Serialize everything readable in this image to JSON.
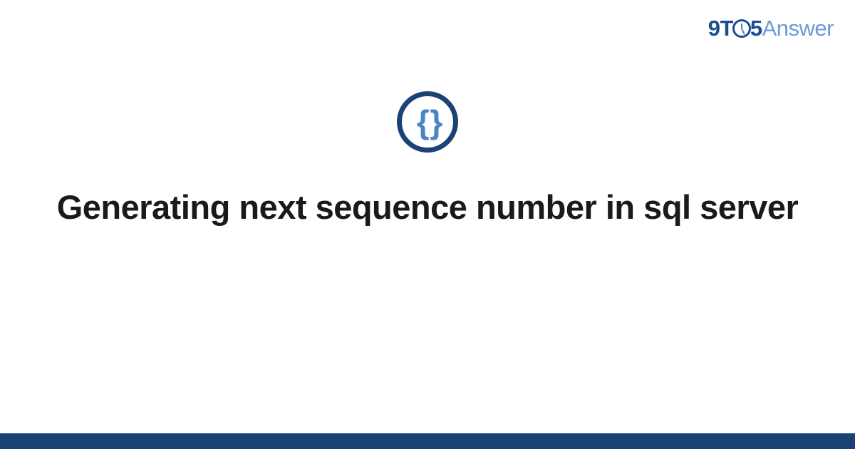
{
  "logo": {
    "nine": "9",
    "t": "T",
    "five": "5",
    "answer": "Answer"
  },
  "icon": {
    "braces": "{ }"
  },
  "title": "Generating next sequence number in sql server"
}
